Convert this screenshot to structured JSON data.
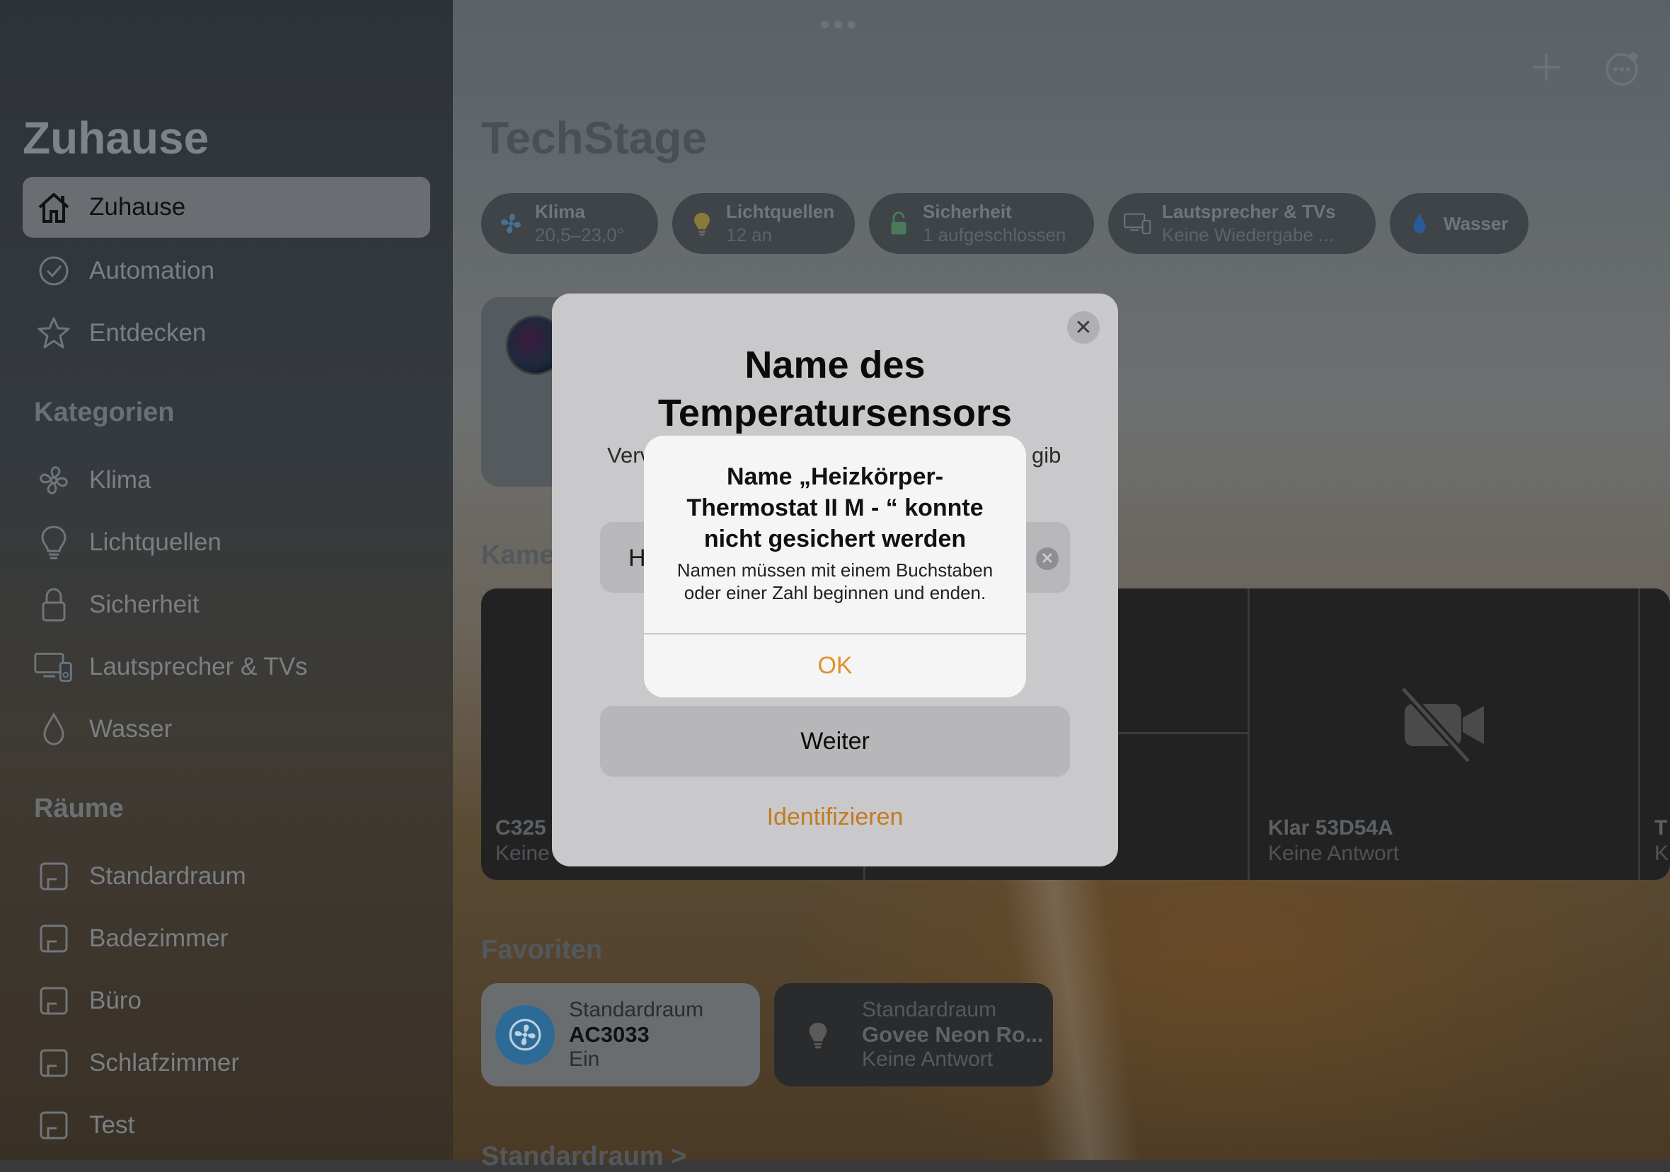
{
  "sidebar": {
    "title": "Zuhause",
    "nav": [
      {
        "label": "Zuhause",
        "icon": "home-icon"
      },
      {
        "label": "Automation",
        "icon": "clock-icon"
      },
      {
        "label": "Entdecken",
        "icon": "star-icon"
      }
    ],
    "categories_title": "Kategorien",
    "categories": [
      {
        "label": "Klima",
        "icon": "fan-icon"
      },
      {
        "label": "Lichtquellen",
        "icon": "bulb-icon"
      },
      {
        "label": "Sicherheit",
        "icon": "lock-icon"
      },
      {
        "label": "Lautsprecher & TVs",
        "icon": "tv-speaker-icon"
      },
      {
        "label": "Wasser",
        "icon": "drop-icon"
      }
    ],
    "rooms_title": "Räume",
    "rooms": [
      {
        "label": "Standardraum",
        "icon": "room-icon"
      },
      {
        "label": "Badezimmer",
        "icon": "room-icon"
      },
      {
        "label": "Büro",
        "icon": "room-icon"
      },
      {
        "label": "Schlafzimmer",
        "icon": "room-icon"
      },
      {
        "label": "Test",
        "icon": "room-icon"
      }
    ]
  },
  "main": {
    "title": "TechStage",
    "chips": [
      {
        "title": "Klima",
        "sub": "20,5–23,0°",
        "icon": "fan-icon"
      },
      {
        "title": "Lichtquellen",
        "sub": "12 an",
        "icon": "bulb-icon"
      },
      {
        "title": "Sicherheit",
        "sub": "1 aufgeschlossen",
        "icon": "lock-icon"
      },
      {
        "title": "Lautsprecher & TVs",
        "sub": "Keine Wiedergabe ...",
        "icon": "tv-speaker-icon"
      },
      {
        "title": "Wasser",
        "sub": "",
        "icon": "drop-icon"
      }
    ],
    "cameras_label": "Kame",
    "cameras": [
      {
        "name": "C325",
        "status": "Keine"
      },
      {
        "name": "Klar 53D54A",
        "status": "Keine Antwort"
      },
      {
        "name": "T",
        "status": "K"
      }
    ],
    "favorites_label": "Favoriten",
    "favorites": [
      {
        "room": "Standardraum",
        "name": "AC3033",
        "status": "Ein",
        "icon": "fan-icon"
      },
      {
        "room": "Standardraum",
        "name": "Govee Neon Ro...",
        "status": "Keine Antwort",
        "icon": "bulb-icon"
      }
    ],
    "room_section": "Standardraum >"
  },
  "sheet": {
    "title_line1": "Name des",
    "title_line2": "Temperatursensors",
    "desc_left": "Verv",
    "desc_right": "gib",
    "input_value": "H",
    "continue_label": "Weiter",
    "identify_label": "Identifizieren"
  },
  "alert": {
    "title_line1": "Name „Heizkörper-",
    "title_line2": "Thermostat II M - “ konnte",
    "title_line3": "nicht gesichert werden",
    "msg_line1": "Namen müssen mit einem Buchstaben",
    "msg_line2": "oder einer Zahl beginnen und enden.",
    "ok_label": "OK"
  },
  "colors": {
    "accent": "#e0902a",
    "identify": "#c37a1e"
  }
}
